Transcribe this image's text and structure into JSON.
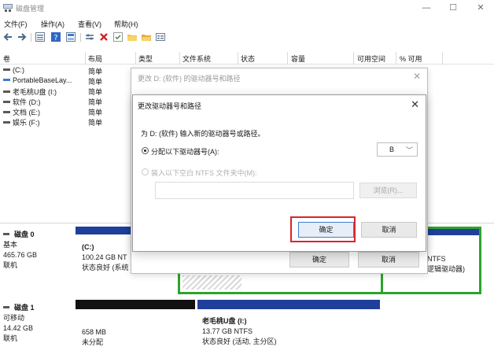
{
  "window": {
    "title": "磁盘管理",
    "controls": {
      "min": "—",
      "max": "☐",
      "close": "✕"
    }
  },
  "menu": [
    "文件(F)",
    "操作(A)",
    "查看(V)",
    "帮助(H)"
  ],
  "toolbar": {
    "icons": [
      "back-arrow-icon",
      "forward-arrow-icon",
      "volume-list-icon",
      "help-icon",
      "graphic-view-icon",
      "connect-icon",
      "delete-icon",
      "check-icon",
      "folder-icon",
      "folder-open-icon",
      "properties-icon"
    ]
  },
  "columns": [
    "卷",
    "布局",
    "类型",
    "文件系统",
    "状态",
    "容量",
    "可用空间",
    "% 可用"
  ],
  "volumes": [
    {
      "name": "(C:)",
      "layout": "简单",
      "color": "#5a5a5a"
    },
    {
      "name": "PortableBaseLay...",
      "layout": "简单",
      "color": "#3c7bd6"
    },
    {
      "name": "老毛桃U盘 (I:)",
      "layout": "简单",
      "color": "#5a5a5a"
    },
    {
      "name": "软件 (D:)",
      "layout": "简单",
      "color": "#5a5a5a"
    },
    {
      "name": "文档 (E:)",
      "layout": "简单",
      "color": "#5a5a5a"
    },
    {
      "name": "娱乐 (F:)",
      "layout": "简单",
      "color": "#5a5a5a"
    }
  ],
  "disks": [
    {
      "title": "磁盘 0",
      "type": "基本",
      "size": "465.76 GB",
      "status": "联机",
      "partitions": [
        {
          "name": "(C:)",
          "size": "100.24 GB NT",
          "status": "状态良好 (系统"
        },
        {
          "name": "",
          "size": "NTFS",
          "status": "逻辑驱动器)"
        }
      ]
    },
    {
      "title": "磁盘 1",
      "type": "可移动",
      "size": "14.42 GB",
      "status": "联机",
      "partitions": [
        {
          "name": "",
          "size": "658 MB",
          "status": "未分配"
        },
        {
          "name": "老毛桃U盘 (I:)",
          "size": "13.77 GB NTFS",
          "status": "状态良好 (活动, 主分区)"
        }
      ]
    }
  ],
  "dialog_back": {
    "title": "更改 D: (软件) 的驱动器号和路径",
    "close": "✕",
    "ok": "确定",
    "cancel": "取消"
  },
  "dialog": {
    "title": "更改驱动器号和路径",
    "close": "✕",
    "prompt": "为 D: (软件) 输入新的驱动器号或路径。",
    "option_assign": "分配以下驱动器号(A):",
    "option_mount": "装入以下空白 NTFS 文件夹中(M):",
    "drive_letter": "B",
    "browse": "浏览(R)...",
    "ok": "确定",
    "cancel": "取消"
  }
}
